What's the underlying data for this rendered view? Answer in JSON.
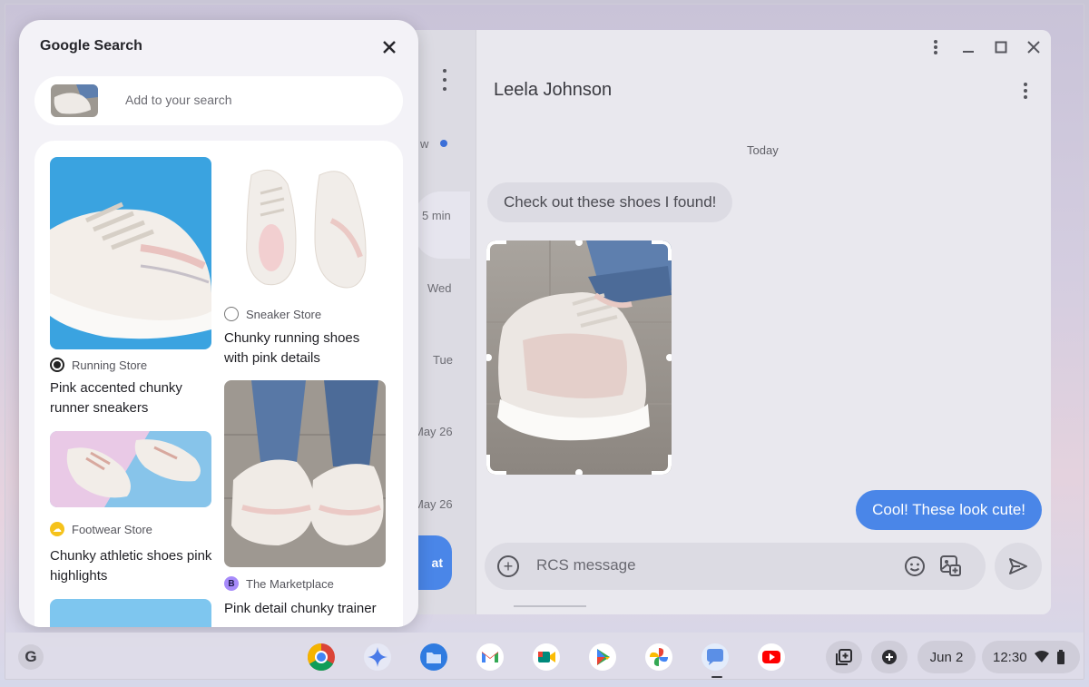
{
  "messages_app": {
    "conversation_list": {
      "fragments": [
        {
          "text": "w"
        },
        {
          "text": "5 min"
        },
        {
          "text": "Wed"
        },
        {
          "text": "Tue"
        },
        {
          "text": "May 26"
        },
        {
          "text": "May 26"
        }
      ],
      "start_chat_label": "at"
    },
    "chat": {
      "contact_name": "Leela Johnson",
      "day_label": "Today",
      "incoming_message": "Check out these shoes I found!",
      "outgoing_message": "Cool! These look cute!",
      "compose_placeholder": "RCS message"
    }
  },
  "search_panel": {
    "title": "Google Search",
    "query_placeholder": "Add to your search",
    "results": [
      {
        "store": "Running Store",
        "title": "Pink accented chunky runner sneakers",
        "store_icon": "circle-filled-black"
      },
      {
        "store": "Sneaker Store",
        "title": "Chunky running shoes with pink details",
        "store_icon": "circle-outline"
      },
      {
        "store": "Footwear Store",
        "title": "Chunky athletic shoes pink highlights",
        "store_icon": "yellow-cloud-icon"
      },
      {
        "store": "The Marketplace",
        "title": "Pink detail chunky trainer",
        "store_icon": "B"
      }
    ]
  },
  "shelf": {
    "launcher_letter": "G",
    "apps": [
      "chrome",
      "gemini",
      "files",
      "gmail",
      "meet",
      "play-store",
      "photos",
      "messages",
      "youtube"
    ],
    "date": "Jun 2",
    "time": "12:30"
  },
  "colors": {
    "accent_blue": "#4a86e8",
    "panel_bg": "#f3f2f7"
  }
}
